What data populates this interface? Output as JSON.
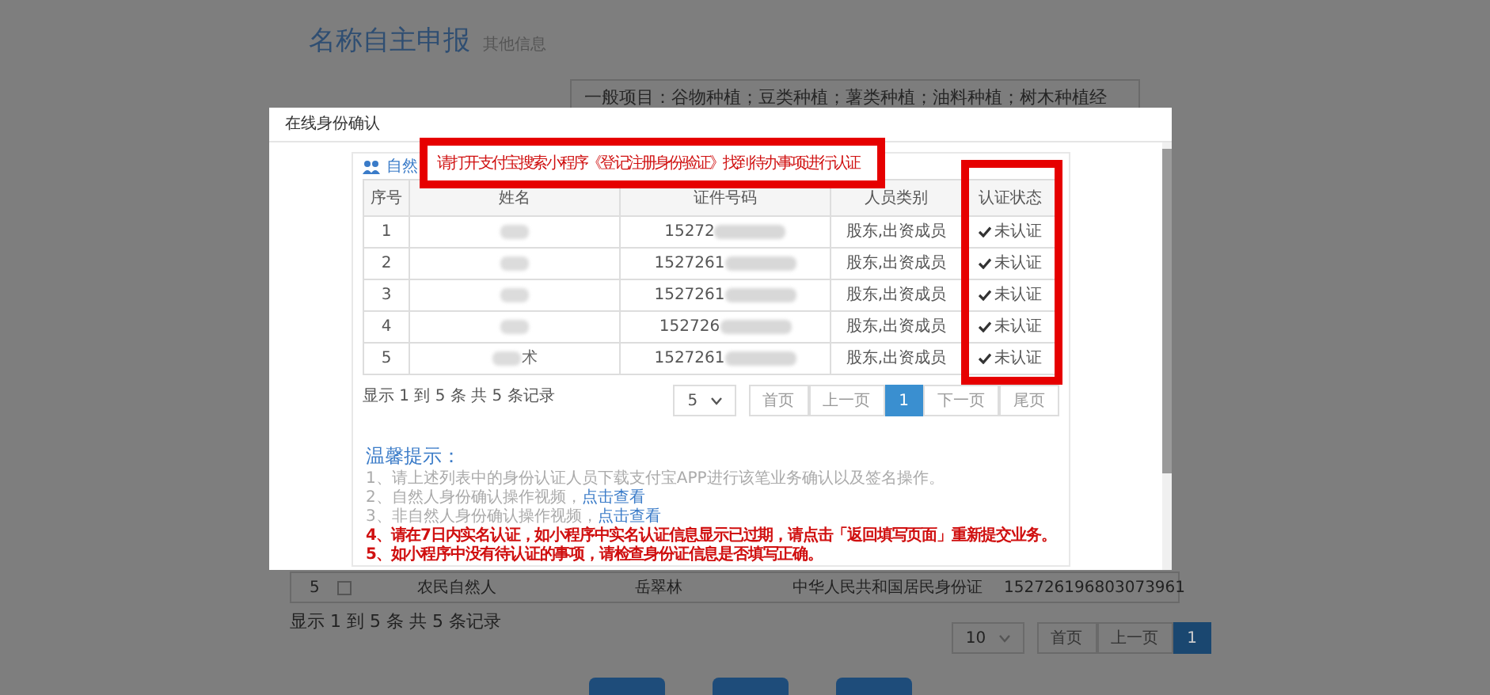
{
  "background": {
    "title": "名称自主申报",
    "subtitle": "其他信息",
    "scope_text": "一般项目：谷物种植；豆类种植；薯类种植；油料种植；树木种植经",
    "table_row": {
      "cells": [
        "5",
        "农民自然人",
        "岳翠林",
        "中华人民共和国居民身份证",
        "152726196803073961"
      ],
      "checked": false
    },
    "summary": "显示 1 到 5 条 共 5 条记录",
    "page_size": "10",
    "pagination": [
      {
        "label": "首页",
        "selected": false
      },
      {
        "label": "上一页",
        "selected": false
      },
      {
        "label": "1",
        "selected": true
      }
    ]
  },
  "dialog": {
    "title": "在线身份确认",
    "panel_heading": "自然",
    "notice": "请打开支付宝搜索小程序《登记注册身份验证》找到待办事项进行认证",
    "table": {
      "columns": [
        "序号",
        "姓名",
        "证件号码",
        "人员类别",
        "认证状态"
      ],
      "rows": [
        {
          "index": "1",
          "id_number": "15272",
          "category": "股东,出资成员",
          "status": "未认证"
        },
        {
          "index": "2",
          "id_number": "1527261",
          "category": "股东,出资成员",
          "status": "未认证"
        },
        {
          "index": "3",
          "id_number": "1527261",
          "category": "股东,出资成员",
          "status": "未认证"
        },
        {
          "index": "4",
          "id_number": "152726",
          "category": "股东,出资成员",
          "status": "未认证"
        },
        {
          "index": "5",
          "name": "术",
          "id_number": "1527261",
          "category": "股东,出资成员",
          "status": "未认证"
        }
      ]
    },
    "summary": "显示 1 到 5 条 共 5 条记录",
    "page_size": "5",
    "pagination": [
      {
        "label": "首页",
        "selected": false
      },
      {
        "label": "上一页",
        "selected": false
      },
      {
        "label": "1",
        "selected": true
      },
      {
        "label": "下一页",
        "selected": false
      },
      {
        "label": "尾页",
        "selected": false
      }
    ],
    "tips": {
      "title": "温馨提示：",
      "items": [
        {
          "kind": "note",
          "text": "1、请上述列表中的身份认证人员下载支付宝APP进行该笔业务确认以及签名操作。"
        },
        {
          "kind": "note",
          "text": "2、自然人身份确认操作视频，",
          "link": "点击查看"
        },
        {
          "kind": "note",
          "text": "3、非自然人身份确认操作视频，",
          "link": "点击查看"
        },
        {
          "kind": "warning",
          "text": "4、请在7日内实名认证，如小程序中实名认证信息显示已过期，请点击「返回填写页面」重新提交业务。"
        },
        {
          "kind": "warning",
          "text": "5、如小程序中没有待认证的事项，请检查身份证信息是否填写正确。"
        }
      ]
    }
  }
}
